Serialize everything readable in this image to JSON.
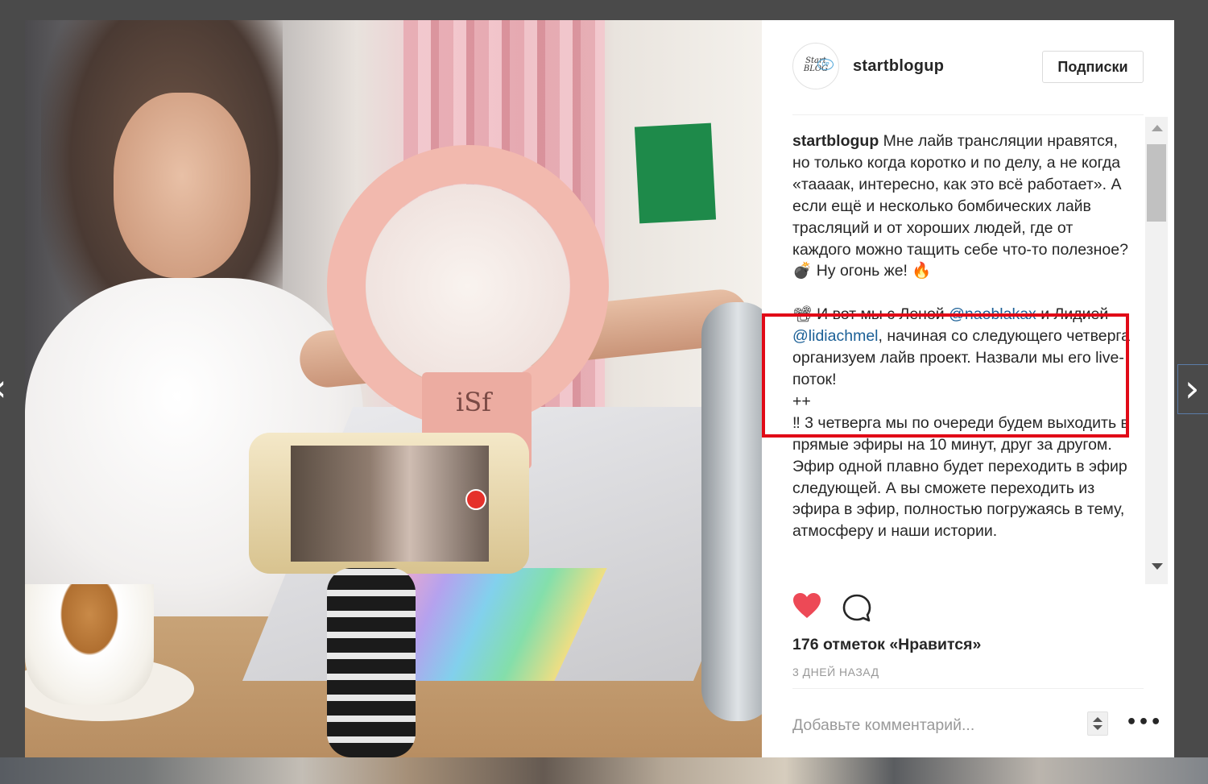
{
  "profile": {
    "avatar_text": "Start BLOG",
    "avatar_badge": "UP",
    "username": "startblogup",
    "follow_label": "Подписки"
  },
  "photo": {
    "ring_logo": "iSf"
  },
  "caption": {
    "author": "startblogup",
    "p1": " Мне лайв трансляции нравятся, но только когда коротко и по делу, а не когда «тааaак, интересно, как это всё работает». А если ещё и несколько бомбических лайв трасляций и от хороших людей, где от каждого можно тащить себе что-то полезное?",
    "p2_emoji1": "💣",
    "p2_text": " Ну огонь же! ",
    "p2_emoji2": "🔥",
    "p3_emoji": "📽",
    "p3_a": " И вот мы с Леной ",
    "p3_mention1": "@naoblakax",
    "p3_b": " и Лидией ",
    "p3_mention2": "@lidiachmel",
    "p3_c": ", начиная со следующего четверга организуем лайв проект. Назвали мы его live-поток!",
    "p4": "++",
    "p5": "‼ 3 четверга мы по очереди будем выходить в прямые эфиры на 10 минут, друг за другом. Эфир одной плавно будет переходить в эфир следующей. А вы сможете переходить из эфира в эфир, полностью погружаясь в тему, атмосферу и наши истории."
  },
  "likes_text": "176 отметок «Нравится»",
  "date_text": "3 ДНЕЙ НАЗАД",
  "comment": {
    "placeholder": "Добавьте комментарий..."
  },
  "more_label": "•••",
  "nav": {
    "prev": "‹",
    "next": "›"
  },
  "colors": {
    "highlight": "#e10a17",
    "heart": "#ed4956",
    "mention": "#1a5f96"
  },
  "icons": [
    "heart-icon",
    "comment-icon",
    "chevron-left-icon",
    "chevron-right-icon",
    "more-icon"
  ]
}
